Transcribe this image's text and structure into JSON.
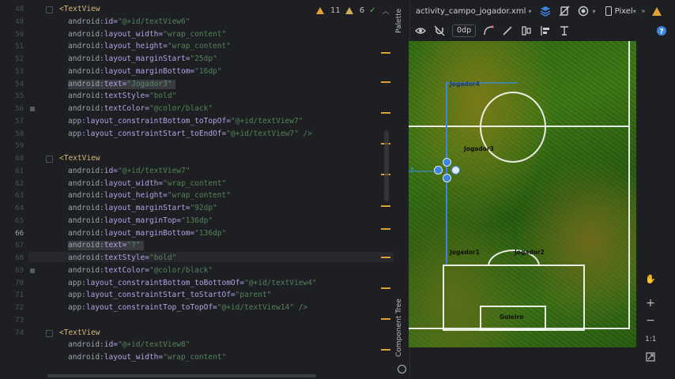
{
  "editor": {
    "line_numbers": [
      "48",
      "49",
      "50",
      "51",
      "52",
      "53",
      "54",
      "55",
      "56",
      "57",
      "58",
      "59",
      "60",
      "61",
      "62",
      "63",
      "64",
      "65",
      "66",
      "67",
      "68",
      "69",
      "70",
      "71",
      "72",
      "73",
      "74"
    ],
    "current_line": "66",
    "lines": [
      {
        "kind": "tag",
        "text": "<TextView"
      },
      {
        "kind": "attr",
        "ns": "android:",
        "name": "id=",
        "value": "\"@+id/textView6\""
      },
      {
        "kind": "attr",
        "ns": "android:",
        "name": "layout_width=",
        "value": "\"wrap_content\""
      },
      {
        "kind": "attr",
        "ns": "android:",
        "name": "layout_height=",
        "value": "\"wrap_content\""
      },
      {
        "kind": "attr",
        "ns": "android:",
        "name": "layout_marginStart=",
        "value": "\"25dp\""
      },
      {
        "kind": "attr",
        "ns": "android:",
        "name": "layout_marginBottom=",
        "value": "\"16dp\""
      },
      {
        "kind": "attr",
        "ns": "android:",
        "name": "text=",
        "value": "\"Jogador3\"",
        "highlight": true
      },
      {
        "kind": "attr",
        "ns": "android:",
        "name": "textStyle=",
        "value": "\"bold\""
      },
      {
        "kind": "attr",
        "ns": "android:",
        "name": "textColor=",
        "value": "\"@color/black\""
      },
      {
        "kind": "attr",
        "ns": "app:",
        "name": "layout_constraintBottom_toTopOf=",
        "value": "\"@+id/textView7\""
      },
      {
        "kind": "attr",
        "ns": "app:",
        "name": "layout_constraintStart_toEndOf=",
        "value": "\"@+id/textView7\" />"
      },
      {
        "kind": "blank",
        "text": ""
      },
      {
        "kind": "tag",
        "text": "<TextView"
      },
      {
        "kind": "attr",
        "ns": "android:",
        "name": "id=",
        "value": "\"@+id/textView7\""
      },
      {
        "kind": "attr",
        "ns": "android:",
        "name": "layout_width=",
        "value": "\"wrap_content\""
      },
      {
        "kind": "attr",
        "ns": "android:",
        "name": "layout_height=",
        "value": "\"wrap_content\""
      },
      {
        "kind": "attr",
        "ns": "android:",
        "name": "layout_marginStart=",
        "value": "\"92dp\""
      },
      {
        "kind": "attr",
        "ns": "android:",
        "name": "layout_marginTop=",
        "value": "\"136dp\""
      },
      {
        "kind": "attr",
        "ns": "android:",
        "name": "layout_marginBottom=",
        "value": "\"136dp\""
      },
      {
        "kind": "attr",
        "ns": "android:",
        "name": "text=",
        "value": "\"?\"",
        "highlight": true
      },
      {
        "kind": "attr",
        "ns": "android:",
        "name": "textStyle=",
        "value": "\"bold\""
      },
      {
        "kind": "attr",
        "ns": "android:",
        "name": "textColor=",
        "value": "\"@color/black\""
      },
      {
        "kind": "attr",
        "ns": "app:",
        "name": "layout_constraintBottom_toBottomOf=",
        "value": "\"@+id/textView4\""
      },
      {
        "kind": "attr",
        "ns": "app:",
        "name": "layout_constraintStart_toStartOf=",
        "value": "\"parent\""
      },
      {
        "kind": "attr",
        "ns": "app:",
        "name": "layout_constraintTop_toTopOf=",
        "value": "\"@+id/textView14\" />"
      },
      {
        "kind": "blank",
        "text": ""
      },
      {
        "kind": "tag",
        "text": "<TextView"
      },
      {
        "kind": "attr",
        "ns": "android:",
        "name": "id=",
        "value": "\"@+id/textView8\""
      },
      {
        "kind": "attr",
        "ns": "android:",
        "name": "layout_width=",
        "value": "\"wrap_content\""
      }
    ]
  },
  "inspections": {
    "warnings": "11",
    "weak_warnings": "6"
  },
  "design": {
    "file_tab": "activity_campo_jogador.xml",
    "device": "Pixel",
    "dp_value": "0dp",
    "side_tabs": {
      "palette": "Palette",
      "component_tree": "Component Tree"
    },
    "field": {
      "players": [
        {
          "label": "Jogador4"
        },
        {
          "label": "Jogador3"
        },
        {
          "label": "Jogador1"
        },
        {
          "label": "Jogador2"
        },
        {
          "label": "Goleiro"
        }
      ],
      "selected_label": "?"
    },
    "zoom_labels": {
      "plus": "+",
      "minus": "−",
      "reset": "1:1"
    }
  },
  "colors": {
    "accent": "#3d86e0",
    "warning": "#e0a33a",
    "ok": "#5fb865"
  }
}
